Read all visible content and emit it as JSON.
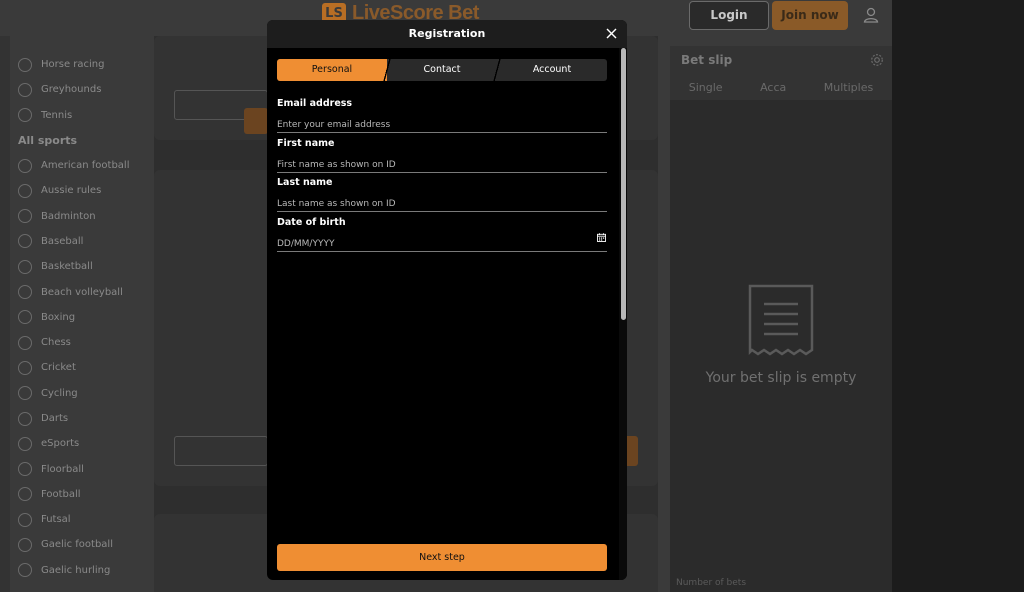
{
  "header": {
    "logo_mark": "LS",
    "logo_text": "LiveScore Bet",
    "login_label": "Login",
    "join_label": "Join now"
  },
  "sidebar": {
    "top_items": [
      "Horse racing",
      "Greyhounds",
      "Tennis"
    ],
    "all_sports_heading": "All sports",
    "sports": [
      "American football",
      "Aussie rules",
      "Badminton",
      "Baseball",
      "Basketball",
      "Beach volleyball",
      "Boxing",
      "Chess",
      "Cricket",
      "Cycling",
      "Darts",
      "eSports",
      "Floorball",
      "Football",
      "Futsal",
      "Gaelic football",
      "Gaelic hurling"
    ]
  },
  "betslip": {
    "title": "Bet slip",
    "tabs": [
      "Single",
      "Acca",
      "Multiples"
    ],
    "empty_text": "Your bet slip is empty",
    "bets_count_label": "Number of bets"
  },
  "modal": {
    "title": "Registration",
    "tabs": [
      {
        "label": "Personal",
        "active": true
      },
      {
        "label": "Contact",
        "active": false
      },
      {
        "label": "Account",
        "active": false
      }
    ],
    "fields": {
      "email": {
        "label": "Email address",
        "placeholder": "Enter your email address",
        "value": ""
      },
      "first_name": {
        "label": "First name",
        "placeholder": "First name as shown on ID",
        "value": ""
      },
      "last_name": {
        "label": "Last name",
        "placeholder": "Last name as shown on ID",
        "value": ""
      },
      "dob": {
        "label": "Date of birth",
        "placeholder": "DD/MM/YYYY",
        "value": ""
      }
    },
    "next_label": "Next step"
  },
  "colors": {
    "accent": "#ef8e33",
    "modal_bg": "#000000",
    "overlay_page": "#3a3a3a"
  },
  "icons": {
    "close": "close-icon",
    "calendar": "calendar-icon",
    "user": "user-icon",
    "settings": "gear-icon",
    "receipt": "receipt-icon"
  }
}
